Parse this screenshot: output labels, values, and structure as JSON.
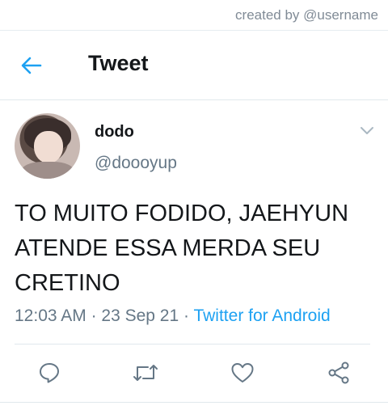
{
  "credit": "created by @username",
  "header": {
    "title": "Tweet"
  },
  "user": {
    "name": "dodo",
    "handle": "@doooyup"
  },
  "tweet": {
    "text": "TO MUITO FODIDO, JAEHYUN ATENDE ESSA MERDA SEU CRETINO",
    "time": "12:03 AM",
    "date": "23 Sep 21",
    "source": "Twitter for Android"
  },
  "icons": {
    "back": "arrow-left-icon",
    "caret": "chevron-down-icon",
    "reply": "reply-icon",
    "retweet": "retweet-icon",
    "like": "heart-icon",
    "share": "share-icon"
  },
  "colors": {
    "accent": "#1da1f2",
    "secondary": "#657786",
    "icon": "#657786"
  }
}
